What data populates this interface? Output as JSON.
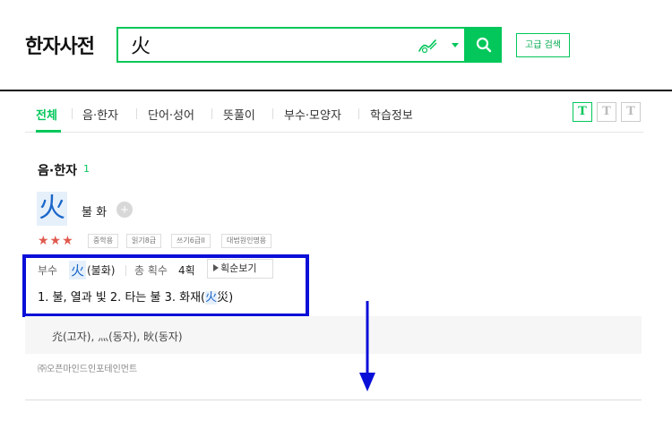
{
  "header": {
    "logo": "한자사전",
    "search_value": "火",
    "adv_search_label": "고급 검색"
  },
  "tabs": [
    {
      "label": "전체",
      "active": true
    },
    {
      "label": "음·한자",
      "active": false
    },
    {
      "label": "단어·성어",
      "active": false
    },
    {
      "label": "뜻풀이",
      "active": false
    },
    {
      "label": "부수·모양자",
      "active": false
    },
    {
      "label": "학습정보",
      "active": false
    }
  ],
  "font_size_buttons": [
    "T",
    "T",
    "T"
  ],
  "section": {
    "title": "음·한자",
    "count": "1"
  },
  "entry": {
    "hanja": "火",
    "reading": "불 화",
    "plus_label": "+",
    "stars": "★★★",
    "badges": [
      "중학용",
      "읽기8급",
      "쓰기6급II",
      "대법원인명용"
    ],
    "radical_label": "부수",
    "radical_char": "火",
    "radical_reading": "(불화)",
    "stroke_label": "총 획수",
    "stroke_value": "4획",
    "stroke_order_label": "획순보기",
    "meaning_prefix": "1. 불, 열과 빛  2. 타는 불  3. 화재(",
    "meaning_hl": "火",
    "meaning_plain": "災",
    "meaning_suffix": ")"
  },
  "related": {
    "text": "灮(고자), 灬(동자), 炚(동자)"
  },
  "source": "㈜오픈마인드인포테인먼트",
  "colors": {
    "brand": "#03c75a",
    "annotation_blue": "#0a0fd8",
    "hanja_blue": "#1b67c9",
    "star_red": "#e0594d"
  }
}
